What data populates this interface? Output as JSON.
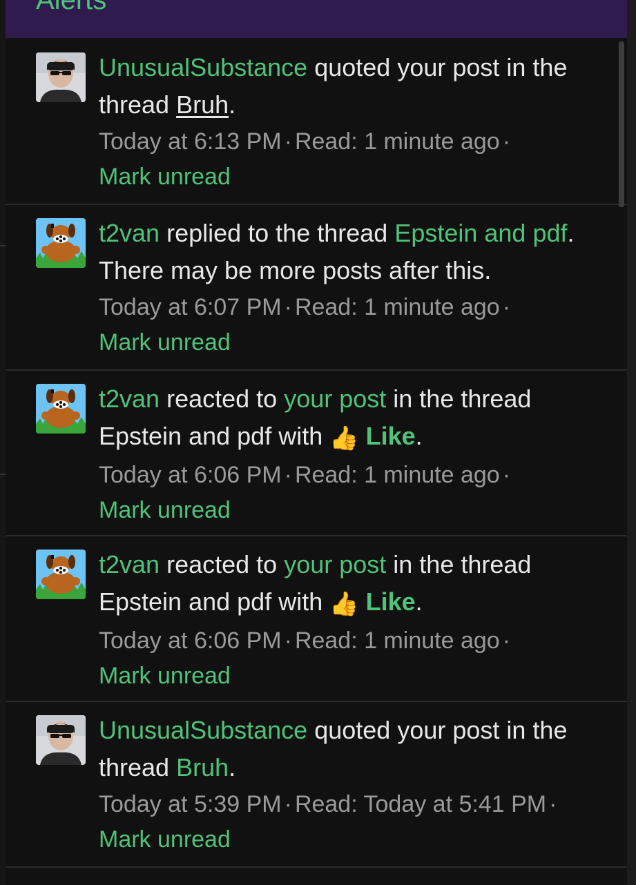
{
  "panel": {
    "title": "Alerts"
  },
  "alerts": [
    {
      "avatar": "avatar-unusualsubstance",
      "user": "UnusualSubstance",
      "action": " quoted your post in the thread ",
      "thread": "Bruh",
      "tail": ".",
      "time": "Today at 6:13 PM",
      "read": "Read: 1 minute ago",
      "mark_unread": "Mark unread"
    },
    {
      "avatar": "avatar-t2van",
      "user": "t2van",
      "action": " replied to the thread ",
      "thread": "Epstein and pdf",
      "tail": ". There may be more posts after this.",
      "time": "Today at 6:07 PM",
      "read": "Read: 1 minute ago",
      "mark_unread": "Mark unread"
    },
    {
      "avatar": "avatar-t2van",
      "user": "t2van",
      "action": " reacted to ",
      "post_link": "your post",
      "mid": " in the thread Epstein and pdf with ",
      "reaction_icon": "👍",
      "reaction": "Like",
      "tail": ".",
      "time": "Today at 6:06 PM",
      "read": "Read: 1 minute ago",
      "mark_unread": "Mark unread"
    },
    {
      "avatar": "avatar-t2van",
      "user": "t2van",
      "action": " reacted to ",
      "post_link": "your post",
      "mid": " in the thread Epstein and pdf with ",
      "reaction_icon": "👍",
      "reaction": "Like",
      "tail": ".",
      "time": "Today at 6:06 PM",
      "read": "Read: 1 minute ago",
      "mark_unread": "Mark unread"
    },
    {
      "avatar": "avatar-unusualsubstance",
      "user": "UnusualSubstance",
      "action": " quoted your post in the thread ",
      "thread": "Bruh",
      "tail": ".",
      "time": "Today at 5:39 PM",
      "read": "Read: Today at 5:41 PM",
      "mark_unread": "Mark unread"
    }
  ],
  "separator": "·",
  "colors": {
    "accent": "#4fc37a",
    "header": "#2f1b4d",
    "background": "#111111",
    "meta": "#9a9a9a"
  }
}
